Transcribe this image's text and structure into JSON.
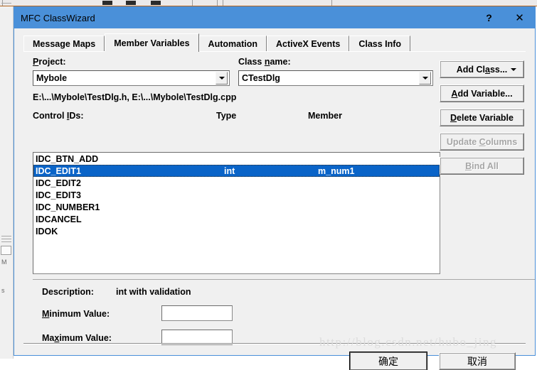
{
  "window": {
    "title": "MFC ClassWizard",
    "help_button": "?",
    "close_button": "✕"
  },
  "tabs": [
    {
      "label": "Message Maps",
      "active": false
    },
    {
      "label": "Member Variables",
      "active": true
    },
    {
      "label": "Automation",
      "active": false
    },
    {
      "label": "ActiveX Events",
      "active": false
    },
    {
      "label": "Class Info",
      "active": false
    }
  ],
  "form": {
    "project_label": "Project:",
    "project_value": "Mybole",
    "class_name_label": "Class name:",
    "class_name_value": "CTestDlg",
    "file_path": "E:\\...\\Mybole\\TestDlg.h, E:\\...\\Mybole\\TestDlg.cpp",
    "control_ids_label": "Control IDs:",
    "type_label": "Type",
    "member_label": "Member"
  },
  "list": {
    "rows": [
      {
        "id": "IDC_BTN_ADD",
        "type": "",
        "member": "",
        "selected": false
      },
      {
        "id": "IDC_EDIT1",
        "type": "int",
        "member": "m_num1",
        "selected": true
      },
      {
        "id": "IDC_EDIT2",
        "type": "",
        "member": "",
        "selected": false
      },
      {
        "id": "IDC_EDIT3",
        "type": "",
        "member": "",
        "selected": false
      },
      {
        "id": "IDC_NUMBER1",
        "type": "",
        "member": "",
        "selected": false
      },
      {
        "id": "IDCANCEL",
        "type": "",
        "member": "",
        "selected": false
      },
      {
        "id": "IDOK",
        "type": "",
        "member": "",
        "selected": false
      }
    ]
  },
  "description": {
    "label": "Description:",
    "value": "int with validation",
    "minimum_label": "Minimum Value:",
    "minimum_value": "",
    "maximum_label": "Maximum Value:",
    "maximum_value": ""
  },
  "side_buttons": [
    {
      "label": "Add Class...",
      "disabled": false,
      "has_caret": true
    },
    {
      "label": "Add Variable...",
      "disabled": false,
      "has_caret": false
    },
    {
      "label": "Delete Variable",
      "disabled": false,
      "has_caret": false
    },
    {
      "label": "Update Columns",
      "disabled": true,
      "has_caret": false
    },
    {
      "label": "Bind All",
      "disabled": true,
      "has_caret": false
    }
  ],
  "footer": {
    "ok_label": "确定",
    "cancel_label": "取消"
  },
  "watermark": "http://blog.csdn.net/hubo_jing",
  "colors": {
    "title_bar": "#4a90d9",
    "selection": "#0a64c8",
    "dialog_face": "#f0f0f0",
    "disabled_text": "#a6a6a6"
  }
}
